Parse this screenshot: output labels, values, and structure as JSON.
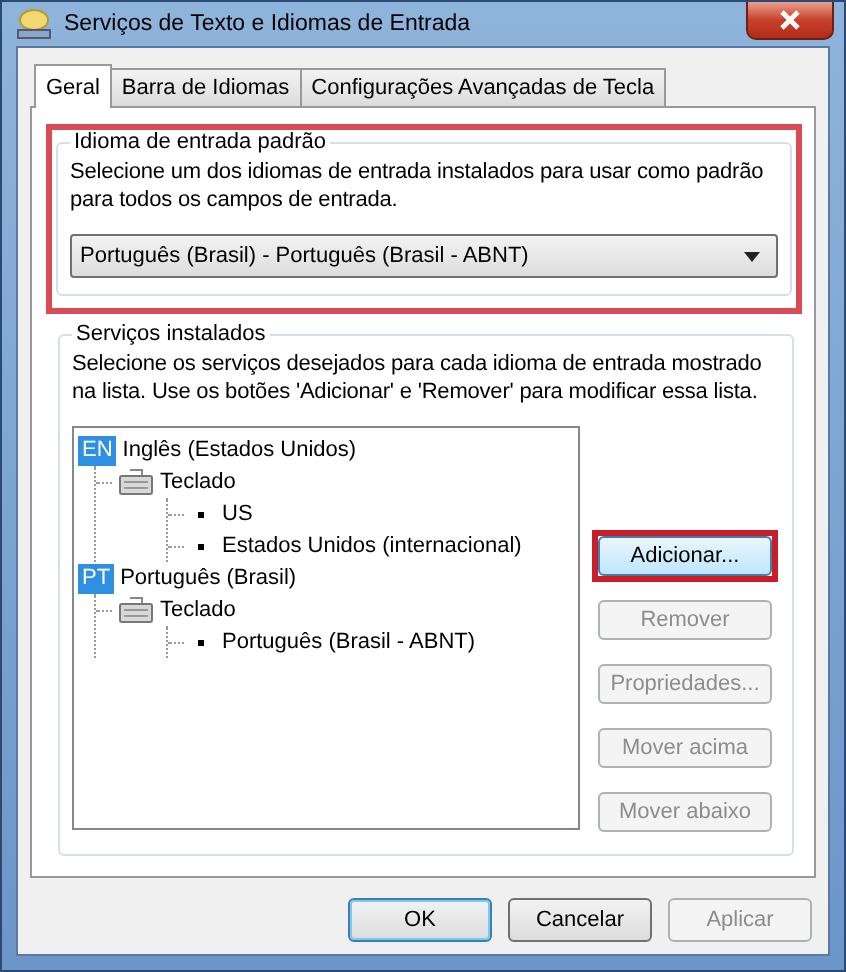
{
  "window": {
    "title": "Serviços de Texto e Idiomas de Entrada"
  },
  "tabs": [
    {
      "label": "Geral",
      "selected": true
    },
    {
      "label": "Barra de Idiomas",
      "selected": false
    },
    {
      "label": "Configurações Avançadas de Tecla",
      "selected": false
    }
  ],
  "default_language": {
    "legend": "Idioma de entrada padrão",
    "highlighted": true,
    "description": "Selecione um dos idiomas de entrada instalados para usar como padrão para todos os campos de entrada.",
    "dropdown": {
      "value": "Português (Brasil) - Português (Brasil - ABNT)"
    }
  },
  "installed_services": {
    "legend": "Serviços instalados",
    "description": "Selecione os serviços desejados para cada idioma de entrada mostrado na lista. Use os botões 'Adicionar' e 'Remover' para modificar essa lista.",
    "tree": [
      {
        "kind": "language",
        "badge": "EN",
        "label": "Inglês (Estados Unidos)",
        "children": [
          {
            "kind": "input_type",
            "label": "Teclado",
            "children": [
              {
                "kind": "layout",
                "label": "US"
              },
              {
                "kind": "layout",
                "label": "Estados Unidos (internacional)"
              }
            ]
          }
        ]
      },
      {
        "kind": "language",
        "badge": "PT",
        "label": "Português (Brasil)",
        "children": [
          {
            "kind": "input_type",
            "label": "Teclado",
            "children": [
              {
                "kind": "layout",
                "label": "Português (Brasil - ABNT)"
              }
            ]
          }
        ]
      }
    ],
    "buttons": [
      {
        "label": "Adicionar...",
        "disabled": false,
        "highlighted": true
      },
      {
        "label": "Remover",
        "disabled": true,
        "highlighted": false
      },
      {
        "label": "Propriedades...",
        "disabled": true,
        "highlighted": false
      },
      {
        "label": "Mover acima",
        "disabled": true,
        "highlighted": false
      },
      {
        "label": "Mover abaixo",
        "disabled": true,
        "highlighted": false
      }
    ]
  },
  "footer_buttons": [
    {
      "label": "OK",
      "disabled": false,
      "default": true
    },
    {
      "label": "Cancelar",
      "disabled": false,
      "default": false
    },
    {
      "label": "Aplicar",
      "disabled": true,
      "default": false
    }
  ]
}
